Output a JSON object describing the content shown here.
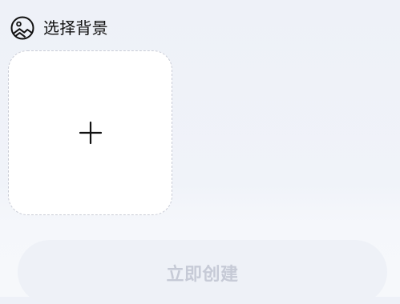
{
  "section": {
    "title": "选择背景",
    "icon": "landscape-image-icon"
  },
  "upload": {
    "icon": "plus-icon"
  },
  "action": {
    "create_label": "立即创建",
    "enabled": false
  },
  "colors": {
    "background": "#eef1f8",
    "tile": "#ffffff",
    "tile_border": "#c9ccd6",
    "title_text": "#111111",
    "button_bg": "#eef1f7",
    "button_text_disabled": "#c6cad6"
  }
}
